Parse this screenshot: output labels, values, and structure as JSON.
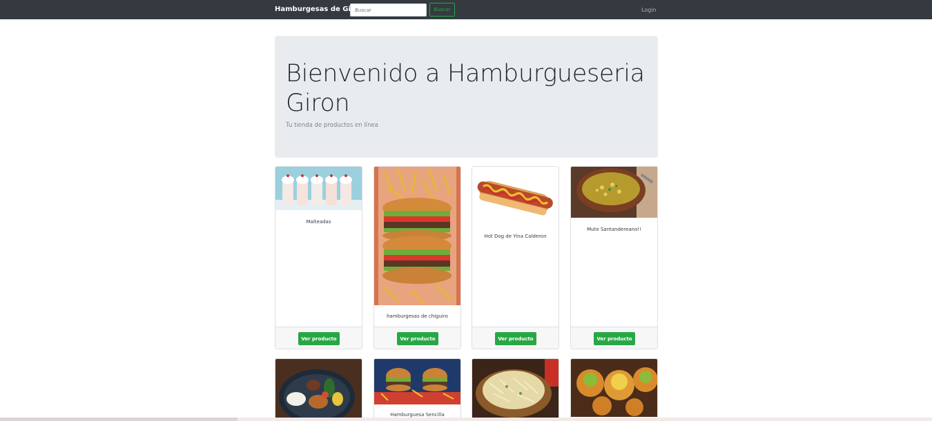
{
  "navbar": {
    "brand": "Hamburgesas de Giron",
    "search_placeholder": "Buscar",
    "search_button": "Buscar",
    "login": "Login"
  },
  "hero": {
    "title": "Bienvenido a Hamburgueseria Giron",
    "subtitle": "Tu tienda de productos en línea"
  },
  "products": [
    {
      "name": "Malteadas",
      "button": "Ver producto"
    },
    {
      "name": "hamburgesas de chiguiro",
      "button": "Ver producto"
    },
    {
      "name": "Hot Dog de Yina Calderon",
      "button": "Ver producto"
    },
    {
      "name": "Mute Santandereano!!",
      "button": "Ver producto"
    },
    {
      "name": "",
      "button": ""
    },
    {
      "name": "Hamburguesa Sencilla",
      "button": ""
    },
    {
      "name": "",
      "button": ""
    },
    {
      "name": "",
      "button": ""
    }
  ],
  "colors": {
    "navbar": "#343a40",
    "jumbotron": "#e9ecef",
    "success": "#28a745"
  }
}
